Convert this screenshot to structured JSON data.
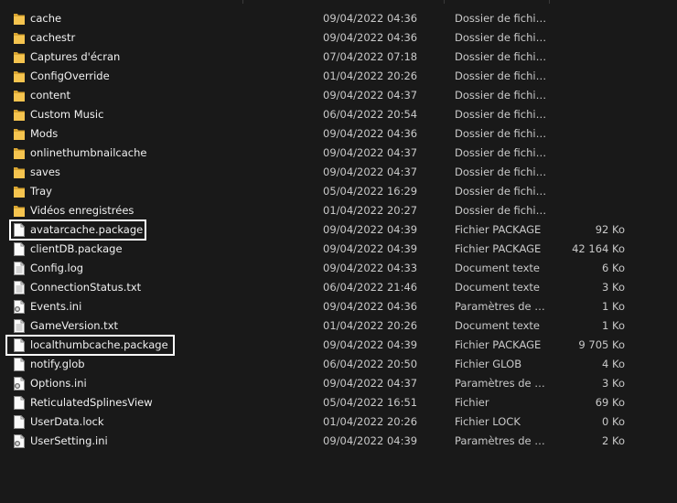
{
  "files": [
    {
      "name": "cache",
      "date": "09/04/2022 04:36",
      "type": "Dossier de fichiers",
      "size": "",
      "icon": "folder-icon"
    },
    {
      "name": "cachestr",
      "date": "09/04/2022 04:36",
      "type": "Dossier de fichiers",
      "size": "",
      "icon": "folder-icon"
    },
    {
      "name": "Captures d'écran",
      "date": "07/04/2022 07:18",
      "type": "Dossier de fichiers",
      "size": "",
      "icon": "folder-icon"
    },
    {
      "name": "ConfigOverride",
      "date": "01/04/2022 20:26",
      "type": "Dossier de fichiers",
      "size": "",
      "icon": "folder-icon"
    },
    {
      "name": "content",
      "date": "09/04/2022 04:37",
      "type": "Dossier de fichiers",
      "size": "",
      "icon": "folder-icon"
    },
    {
      "name": "Custom Music",
      "date": "06/04/2022 20:54",
      "type": "Dossier de fichiers",
      "size": "",
      "icon": "folder-icon"
    },
    {
      "name": "Mods",
      "date": "09/04/2022 04:36",
      "type": "Dossier de fichiers",
      "size": "",
      "icon": "folder-icon"
    },
    {
      "name": "onlinethumbnailcache",
      "date": "09/04/2022 04:37",
      "type": "Dossier de fichiers",
      "size": "",
      "icon": "folder-icon"
    },
    {
      "name": "saves",
      "date": "09/04/2022 04:37",
      "type": "Dossier de fichiers",
      "size": "",
      "icon": "folder-icon"
    },
    {
      "name": "Tray",
      "date": "05/04/2022 16:29",
      "type": "Dossier de fichiers",
      "size": "",
      "icon": "folder-icon"
    },
    {
      "name": "Vidéos enregistrées",
      "date": "01/04/2022 20:27",
      "type": "Dossier de fichiers",
      "size": "",
      "icon": "folder-icon"
    },
    {
      "name": "avatarcache.package",
      "date": "09/04/2022 04:39",
      "type": "Fichier PACKAGE",
      "size": "92 Ko",
      "icon": "file-icon"
    },
    {
      "name": "clientDB.package",
      "date": "09/04/2022 04:39",
      "type": "Fichier PACKAGE",
      "size": "42 164 Ko",
      "icon": "file-icon"
    },
    {
      "name": "Config.log",
      "date": "09/04/2022 04:33",
      "type": "Document texte",
      "size": "6 Ko",
      "icon": "text-file-icon"
    },
    {
      "name": "ConnectionStatus.txt",
      "date": "06/04/2022 21:46",
      "type": "Document texte",
      "size": "3 Ko",
      "icon": "text-file-icon"
    },
    {
      "name": "Events.ini",
      "date": "09/04/2022 04:36",
      "type": "Paramètres de co...",
      "size": "1 Ko",
      "icon": "settings-file-icon"
    },
    {
      "name": "GameVersion.txt",
      "date": "01/04/2022 20:26",
      "type": "Document texte",
      "size": "1 Ko",
      "icon": "text-file-icon"
    },
    {
      "name": "localthumbcache.package",
      "date": "09/04/2022 04:39",
      "type": "Fichier PACKAGE",
      "size": "9 705 Ko",
      "icon": "file-icon"
    },
    {
      "name": "notify.glob",
      "date": "06/04/2022 20:50",
      "type": "Fichier GLOB",
      "size": "4 Ko",
      "icon": "file-icon"
    },
    {
      "name": "Options.ini",
      "date": "09/04/2022 04:37",
      "type": "Paramètres de co...",
      "size": "3 Ko",
      "icon": "settings-file-icon"
    },
    {
      "name": "ReticulatedSplinesView",
      "date": "05/04/2022 16:51",
      "type": "Fichier",
      "size": "69 Ko",
      "icon": "file-icon"
    },
    {
      "name": "UserData.lock",
      "date": "01/04/2022 20:26",
      "type": "Fichier LOCK",
      "size": "0 Ko",
      "icon": "file-icon"
    },
    {
      "name": "UserSetting.ini",
      "date": "09/04/2022 04:39",
      "type": "Paramètres de co...",
      "size": "2 Ko",
      "icon": "settings-file-icon"
    }
  ],
  "colors": {
    "background": "#191919",
    "folder": "#f2c14e",
    "file": "#ffffff",
    "highlight_border": "#ffffff"
  }
}
